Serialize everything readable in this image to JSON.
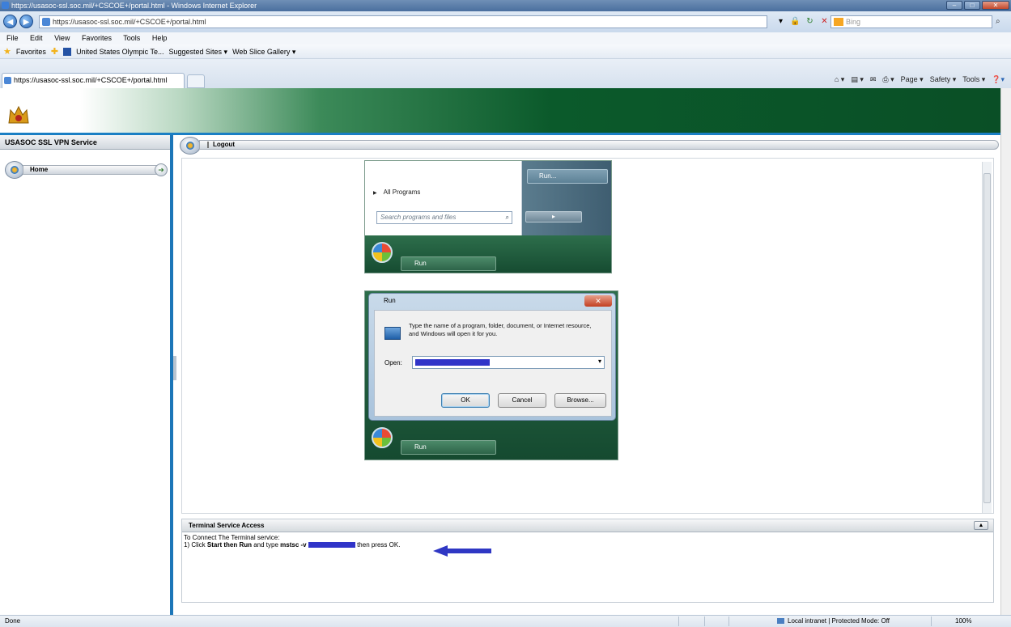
{
  "window": {
    "title": "https://usasoc-ssl.soc.mil/+CSCOE+/portal.html - Windows Internet Explorer",
    "controls": [
      "–",
      "□",
      "✕"
    ]
  },
  "address_bar": {
    "url": "https://usasoc-ssl.soc.mil/+CSCOE+/portal.html",
    "search_placeholder": "Bing"
  },
  "menu": [
    "File",
    "Edit",
    "View",
    "Favorites",
    "Tools",
    "Help"
  ],
  "favorites_bar": {
    "favorites_label": "Favorites",
    "items": [
      "United States Olympic Te...",
      "Suggested Sites ▾",
      "Web Slice Gallery ▾"
    ]
  },
  "tab": {
    "label": "https://usasoc-ssl.soc.mil/+CSCOE+/portal.html"
  },
  "command_bar": [
    "Page ▾",
    "Safety ▾",
    "Tools ▾"
  ],
  "sidebar": {
    "header": "USASOC SSL VPN Service",
    "home_label": "Home"
  },
  "main": {
    "logout_label": "Logout",
    "start_menu_shot": {
      "run_item": "Run...",
      "all_programs": "All Programs",
      "search_placeholder": "Search programs and files",
      "taskbar_run": "Run"
    },
    "run_dialog_shot": {
      "title": "Run",
      "description": "Type the name of a program, folder, document, or Internet resource, and Windows will open it for you.",
      "open_label": "Open:",
      "ok": "OK",
      "cancel": "Cancel",
      "browse": "Browse..."
    }
  },
  "terminal_panel": {
    "title": "Terminal Service Access",
    "line1": "To Connect The Terminal service:",
    "line2_prefix": "1) Click ",
    "line2_bold": "Start then Run",
    "line2_mid": " and type ",
    "line2_cmd": "mstsc -v",
    "line2_suffix": " then press OK."
  },
  "status_bar": {
    "left": "Done",
    "zone": "Local intranet | Protected Mode: Off",
    "zoom": "100%"
  },
  "colors": {
    "banner_green": "#0a4f26",
    "accent_blue": "#1c76b8",
    "redaction": "#3034c8"
  }
}
